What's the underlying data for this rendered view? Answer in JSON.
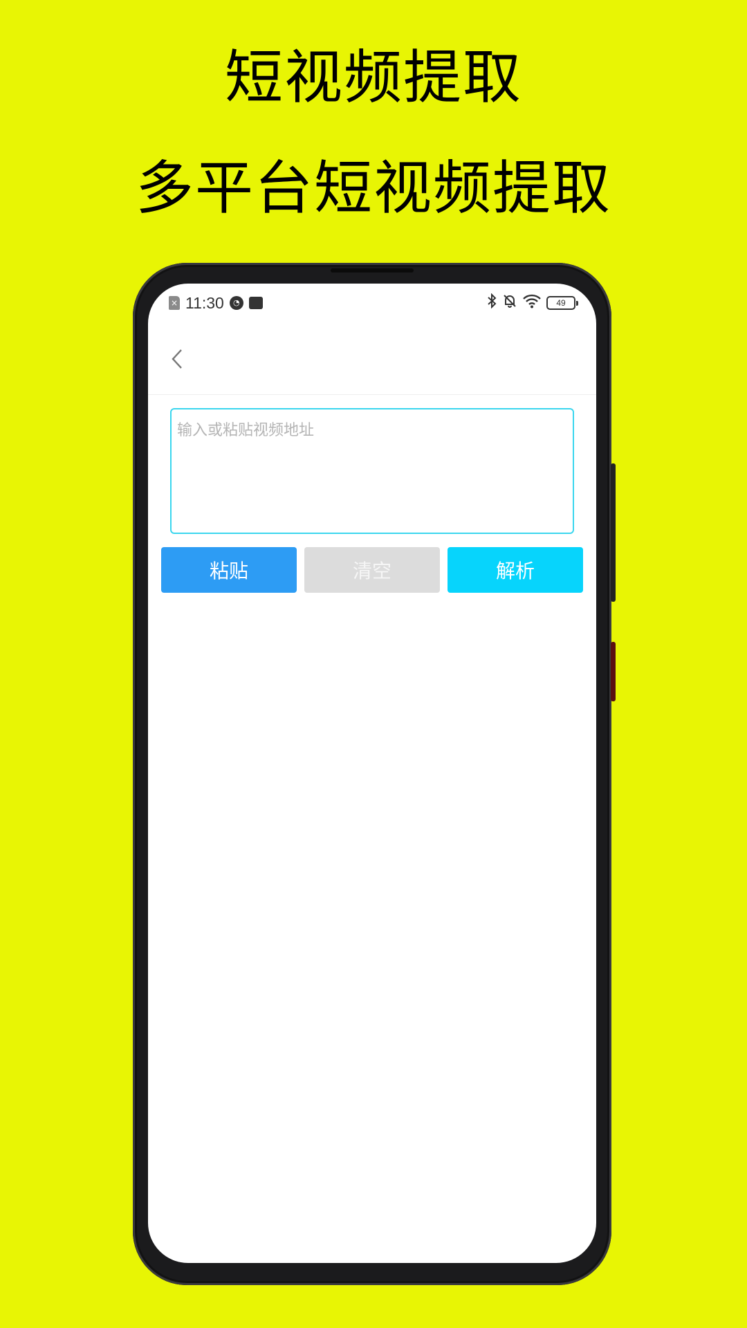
{
  "promo": {
    "title": "短视频提取",
    "subtitle": "多平台短视频提取"
  },
  "status_bar": {
    "time": "11:30",
    "battery": "49",
    "icons": [
      "sim-card-icon",
      "clock-app-icon",
      "message-icon",
      "bluetooth-icon",
      "bell-off-icon",
      "wifi-icon",
      "battery-icon"
    ]
  },
  "app_bar": {
    "back_icon": "chevron-left-icon"
  },
  "url_input": {
    "placeholder": "输入或粘贴视频地址",
    "value": "",
    "border_color": "#3ad6ee"
  },
  "buttons": {
    "paste": "粘贴",
    "clear": "清空",
    "parse": "解析"
  },
  "colors": {
    "background": "#e8f504",
    "paste_button": "#2d9cf4",
    "clear_button": "#dcdcdc",
    "parse_button": "#07d4fc"
  }
}
